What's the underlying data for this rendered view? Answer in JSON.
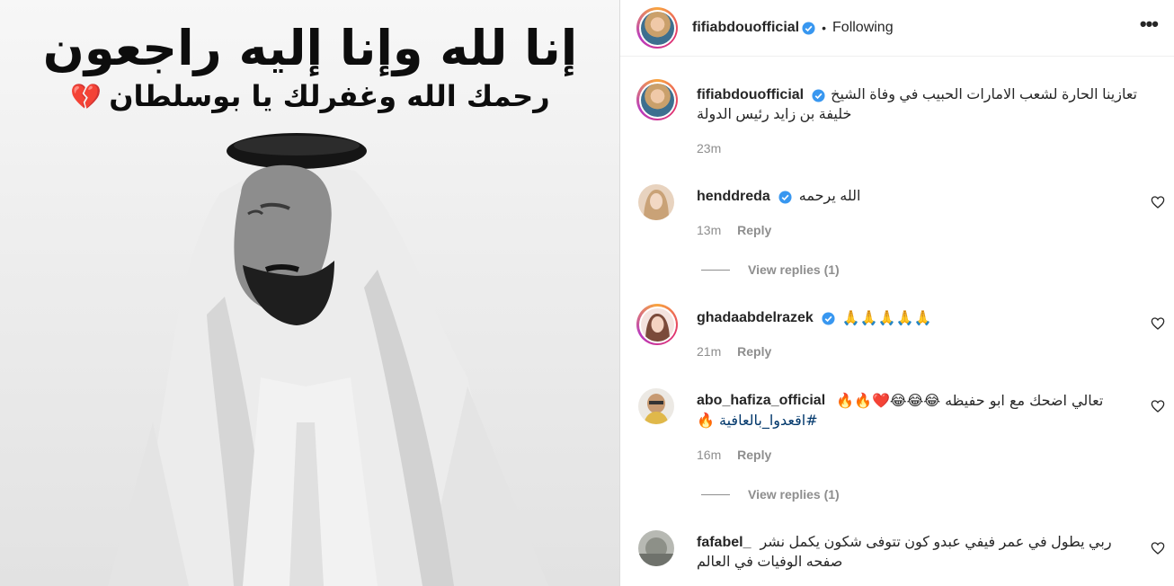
{
  "image": {
    "headline": "إنا لله وإنا إليه راجعون",
    "subline": "رحمك الله وغفرلك يا بوسلطان",
    "heart_emoji": "💔"
  },
  "header": {
    "username": "fifiabdouofficial",
    "separator": "•",
    "follow_status": "Following",
    "more": "•••"
  },
  "caption": {
    "username": "fifiabdouofficial",
    "text_line1": "تعازينا الحارة لشعب الامارات الحبيب في وفاة الشيخ",
    "text_line2": "خليفة بن زايد رئيس الدولة",
    "time": "23m"
  },
  "comments": [
    {
      "username": "henddreda",
      "text": "الله يرحمه",
      "time": "13m",
      "reply_label": "Reply",
      "view_replies": "View replies (1)",
      "verified": true
    },
    {
      "username": "ghadaabdelrazek",
      "text": "🙏🙏🙏🙏🙏",
      "time": "21m",
      "reply_label": "Reply",
      "verified": true
    },
    {
      "username": "abo_hafiza_official",
      "text_line1": "تعالي اضحك مع ابو حفيظه 😂😂😂❤️🔥🔥",
      "text_line2": "#اقعدوا_بالعافية 🔥",
      "time": "16m",
      "reply_label": "Reply",
      "view_replies": "View replies (1)",
      "verified": false
    },
    {
      "username": "fafabel_",
      "text_line1": "ربي يطول في عمر فيفي عبدو كون تتوفى شكون يكمل نشر",
      "text_line2": "صفحه الوفيات في العالم",
      "verified": false
    }
  ],
  "colors": {
    "verified": "#3897f0",
    "muted": "#8e8e8e",
    "text": "#262626",
    "hashtag": "#00376b"
  }
}
